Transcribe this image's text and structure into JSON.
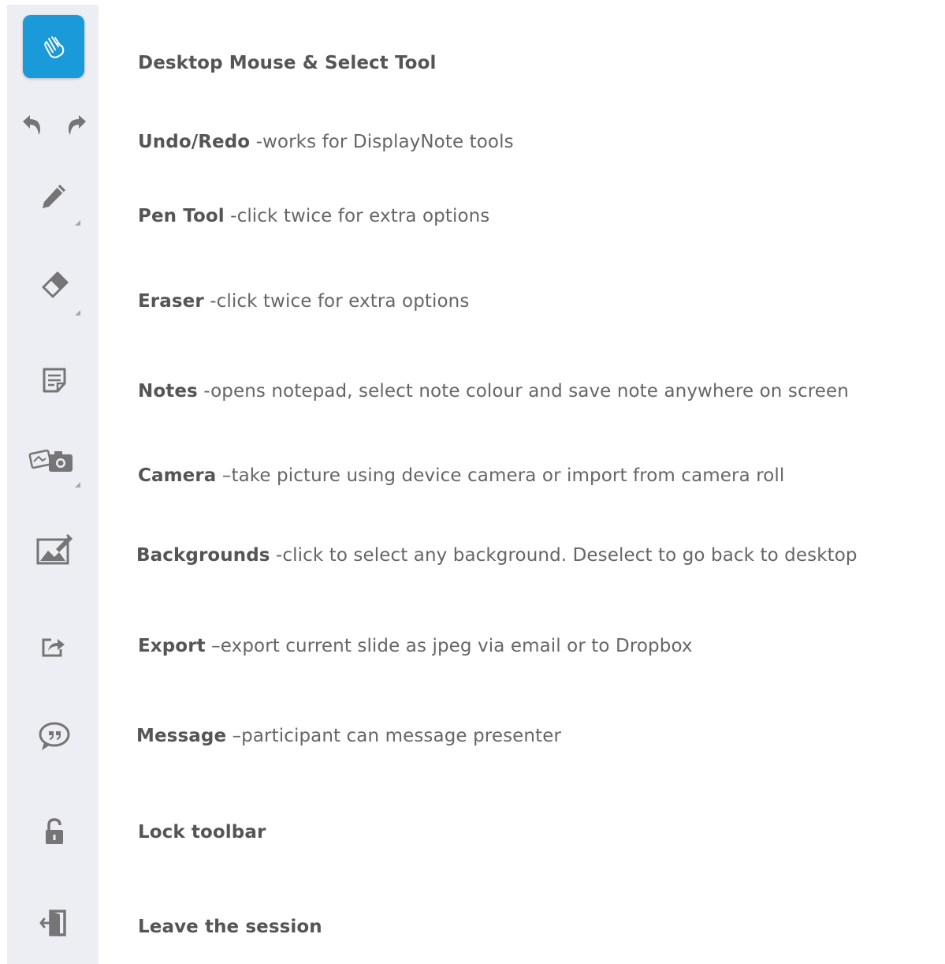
{
  "tools": [
    {
      "id": "select",
      "icon": "hand-pointer-icon",
      "name": "Desktop Mouse & Select Tool",
      "desc": ""
    },
    {
      "id": "undoredo",
      "icon": "undo-redo-icon",
      "name": "Undo/Redo",
      "desc": " -works for DisplayNote tools"
    },
    {
      "id": "pen",
      "icon": "pen-icon",
      "name": "Pen Tool",
      "desc": " -click twice for extra options"
    },
    {
      "id": "eraser",
      "icon": "eraser-icon",
      "name": "Eraser",
      "desc": " -click twice for extra options"
    },
    {
      "id": "notes",
      "icon": "note-icon",
      "name": "Notes",
      "desc": " -opens notepad, select note colour and save note anywhere on screen"
    },
    {
      "id": "camera",
      "icon": "camera-icon",
      "name": "Camera",
      "desc": " –take picture using device camera or import from camera roll"
    },
    {
      "id": "backgrounds",
      "icon": "background-icon",
      "name": "Backgrounds",
      "desc": " -click to select any background.  Deselect to go back to desktop"
    },
    {
      "id": "export",
      "icon": "export-icon",
      "name": "Export",
      "desc": " –export current slide as jpeg via email or to Dropbox"
    },
    {
      "id": "message",
      "icon": "message-icon",
      "name": "Message",
      "desc": " –participant can message presenter"
    },
    {
      "id": "lock",
      "icon": "lock-icon",
      "name": "Lock toolbar",
      "desc": ""
    },
    {
      "id": "leave",
      "icon": "exit-icon",
      "name": "Leave the session",
      "desc": ""
    }
  ],
  "colors": {
    "accent": "#1a9ad9",
    "toolbar_bg": "#eceef3",
    "icon": "#757575",
    "text": "#555555"
  }
}
